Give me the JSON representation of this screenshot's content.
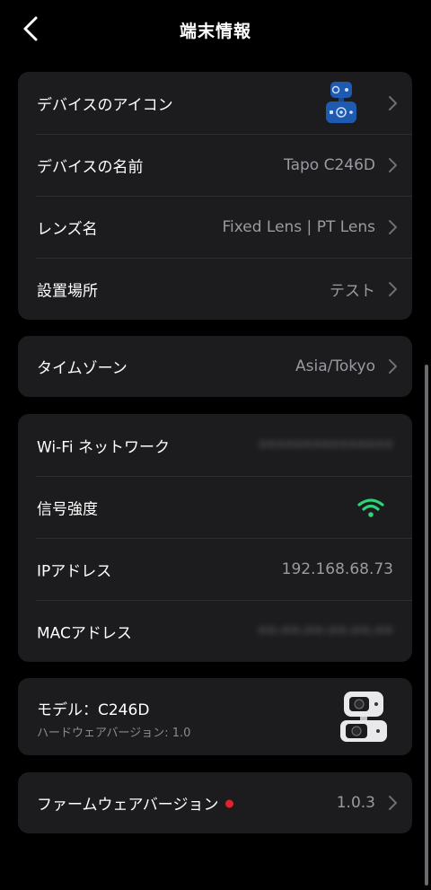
{
  "header": {
    "title": "端末情報"
  },
  "device_card": [
    {
      "label": "デバイスのアイコン",
      "value": ""
    },
    {
      "label": "デバイスの名前",
      "value": "Tapo C246D"
    },
    {
      "label": "レンズ名",
      "value": "Fixed Lens | PT Lens"
    },
    {
      "label": "設置場所",
      "value": "テスト"
    }
  ],
  "timezone": {
    "label": "タイムゾーン",
    "value": "Asia/Tokyo"
  },
  "network_card": [
    {
      "label": "Wi-Fi ネットワーク",
      "value": "•••••••••••••••"
    },
    {
      "label": "信号強度",
      "value": ""
    },
    {
      "label": "IPアドレス",
      "value": "192.168.68.73"
    },
    {
      "label": "MACアドレス",
      "value": "••-••-••-••-••-••"
    }
  ],
  "model": {
    "label": "モデル：C246D",
    "sub": "ハードウェアバージョン: 1.0"
  },
  "firmware": {
    "label": "ファームウェアバージョン",
    "value": "1.0.3"
  },
  "colors": {
    "background": "#000000",
    "card": "#1c1c1e",
    "wifi": "#2fd17a",
    "alert_dot": "#e8202a",
    "icon_blue": "#1e5bb0"
  }
}
